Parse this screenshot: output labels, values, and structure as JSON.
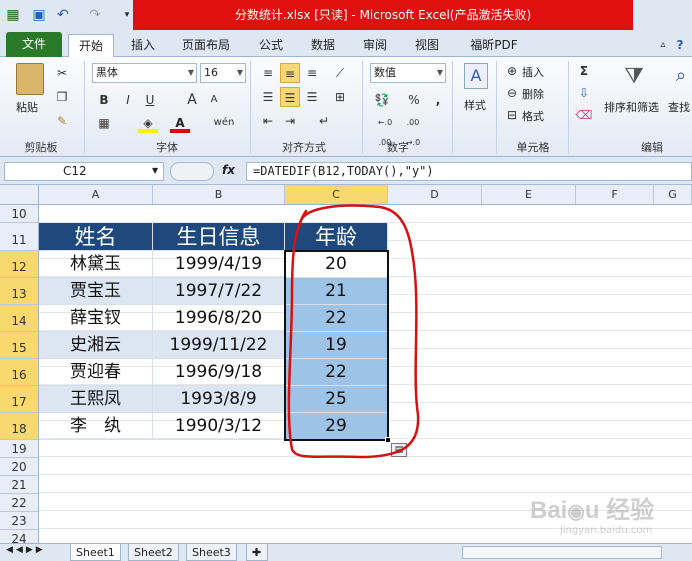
{
  "window": {
    "title": "分数统计.xlsx  [只读]  -  Microsoft Excel(产品激活失败)"
  },
  "ribbon_tabs": [
    "文件",
    "开始",
    "插入",
    "页面布局",
    "公式",
    "数据",
    "审阅",
    "视图",
    "福昕PDF"
  ],
  "clipboard": {
    "paste": "粘贴",
    "label": "剪贴板"
  },
  "font": {
    "name": "黑体",
    "size": "16",
    "label": "字体",
    "bold": "B",
    "italic": "I",
    "underline": "U",
    "grow": "A",
    "shrink": "A",
    "color_letter": "A",
    "wen": "wén"
  },
  "alignment": {
    "label": "对齐方式"
  },
  "number": {
    "format": "数值",
    "label": "数字",
    "percent": "%",
    "comma": ",",
    "inc": "←.0 .00",
    "dec": ".00 →.0"
  },
  "styles": {
    "label": "样式"
  },
  "cells": {
    "insert": "插入",
    "delete": "删除",
    "format": "格式",
    "label": "单元格"
  },
  "editing": {
    "sigma": "Σ",
    "sort": "排序和筛选",
    "find": "查找",
    "label": "编辑"
  },
  "formula_bar": {
    "name_box": "C12",
    "fx": "fx",
    "formula": "=DATEDIF(B12,TODAY(),\"y\")"
  },
  "columns": [
    "A",
    "B",
    "C",
    "D",
    "E",
    "F",
    "G"
  ],
  "rows": [
    "10",
    "11",
    "12",
    "13",
    "14",
    "15",
    "16",
    "17",
    "18",
    "19",
    "20",
    "21",
    "22",
    "23",
    "24"
  ],
  "table": {
    "headers": [
      "姓名",
      "生日信息",
      "年龄"
    ],
    "rows": [
      [
        "林黛玉",
        "1999/4/19",
        "20"
      ],
      [
        "贾宝玉",
        "1997/7/22",
        "21"
      ],
      [
        "薛宝钗",
        "1996/8/20",
        "22"
      ],
      [
        "史湘云",
        "1999/11/22",
        "19"
      ],
      [
        "贾迎春",
        "1996/9/18",
        "22"
      ],
      [
        "王熙凤",
        "1993/8/9",
        "25"
      ],
      [
        "李　纨",
        "1990/3/12",
        "29"
      ]
    ]
  },
  "sheets": [
    "Sheet1",
    "Sheet2",
    "Sheet3"
  ],
  "watermark": "Baidu经验 jingyan.baidu.com",
  "colors": {
    "header_fill": "#1f497d",
    "band": "#dce6f2",
    "selection": "#9dc3e6",
    "annotation": "#d81010"
  }
}
